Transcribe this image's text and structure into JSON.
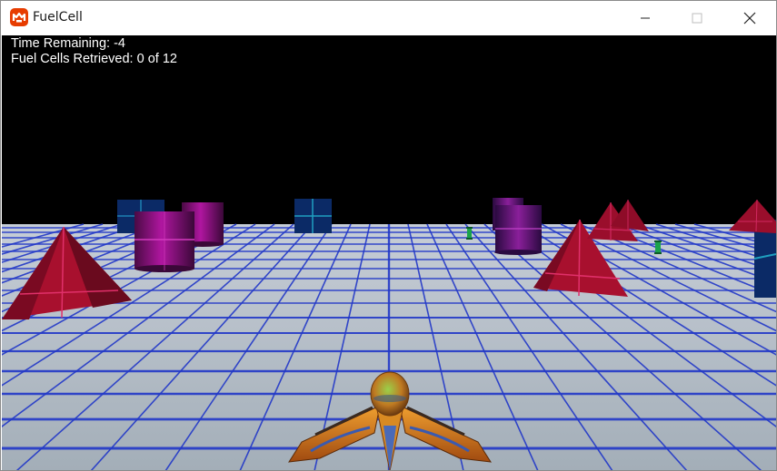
{
  "window": {
    "title": "FuelCell",
    "controls": {
      "minimize": "minimize-icon",
      "maximize": "maximize-icon",
      "close": "close-icon"
    },
    "app_icon": "monogame-logo-icon",
    "app_icon_color": "#e73c00"
  },
  "hud": {
    "time_label": "Time Remaining:",
    "time_value": "-4",
    "fuel_label": "Fuel Cells Retrieved:",
    "fuel_value": "0 of 12"
  },
  "scene": {
    "sky_color": "#000000",
    "ground_color": "#a9b4bf",
    "grid_color": "#1f35c9",
    "barrier_colors": [
      "#8a0f2c",
      "#7a0f6b",
      "#0c2a6b"
    ],
    "fuel_cell_color": "#1aa34a",
    "player_ship_color": "#d9781a"
  }
}
